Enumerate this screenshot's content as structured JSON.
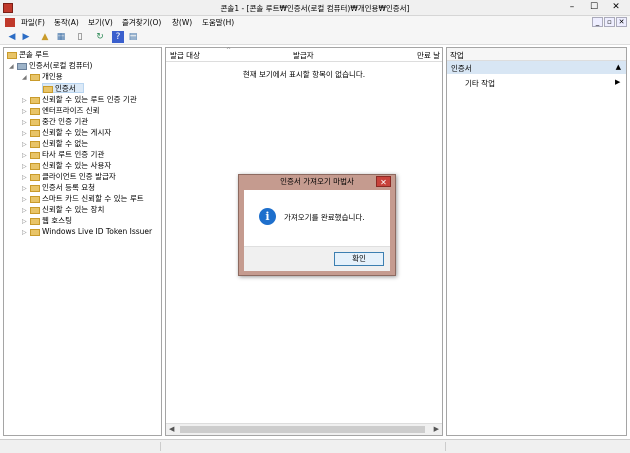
{
  "window": {
    "title": "콘솔1 - [콘솔 루트₩인증서(로컬 컴퓨터)₩개인용₩인증서]",
    "minimize_glyph": "–",
    "maximize_glyph": "☐",
    "close_glyph": "✕"
  },
  "menu": [
    "파일(F)",
    "동작(A)",
    "보기(V)",
    "즐겨찾기(O)",
    "창(W)",
    "도움말(H)"
  ],
  "mdi_buttons": [
    "_",
    "▫",
    "✕"
  ],
  "toolbar": {
    "icons": [
      "back-arrow-icon",
      "forward-arrow-icon",
      "up-folder-icon",
      "show-hide-tree-icon",
      "export-icon",
      "refresh-icon",
      "help-icon",
      "properties-icon"
    ],
    "glyphs": [
      "◀",
      "▶",
      "▲",
      "▦",
      "▯",
      "↻",
      "?",
      "▤"
    ]
  },
  "tree": {
    "root": "콘솔 루트",
    "cert_store": "인증서(로컬 컴퓨터)",
    "personal": "개인용",
    "certificates": "인증서",
    "children": [
      "신뢰할 수 있는 루트 인증 기관",
      "엔터프라이즈 신뢰",
      "중간 인증 기관",
      "신뢰할 수 있는 게시자",
      "신뢰할 수 없는",
      "타사 루트 인증 기관",
      "신뢰할 수 있는 사용자",
      "클라이언트 인증 발급자",
      "인증서 등록 요청",
      "스마트 카드 신뢰할 수 있는 루트",
      "신뢰할 수 있는 장치",
      "웹 호스팅",
      "Windows Live ID Token Issuer"
    ]
  },
  "list": {
    "columns": [
      "발급 대상",
      "발급자",
      "만료 날"
    ],
    "empty_message": "현재 보기에서 표시할 항목이 없습니다."
  },
  "actions": {
    "title": "작업",
    "section": "인증서",
    "item": "기타 작업"
  },
  "dialog": {
    "title": "인증서 가져오기 마법사",
    "message": "가져오기를 완료했습니다.",
    "ok_label": "확인",
    "close_glyph": "✕"
  },
  "colors": {
    "dialog_frame": "#c59b8f",
    "info_icon": "#1e6fcc",
    "close_button": "#c8423b",
    "selection": "#dbe9f7"
  }
}
